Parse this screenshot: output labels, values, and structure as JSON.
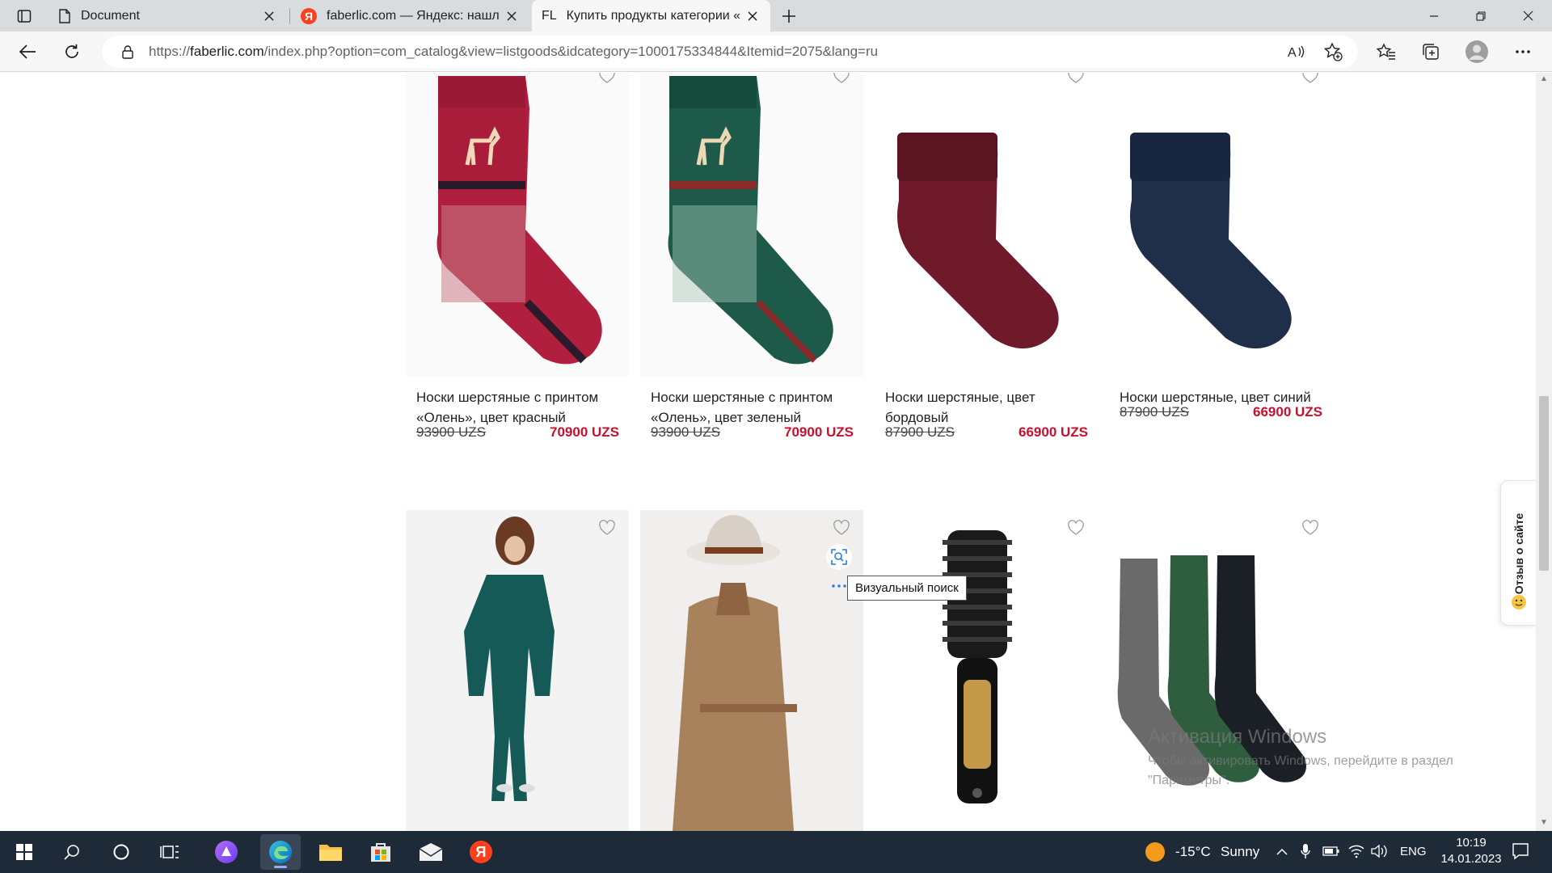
{
  "browser": {
    "tabs": [
      {
        "label": "Document",
        "icon": "document-icon"
      },
      {
        "label": "faberlic.com — Яндекс: нашлось",
        "icon": "yandex-icon"
      },
      {
        "label": "Купить продукты категории «М",
        "icon": "faberlic-icon",
        "favicon_text": "FL"
      }
    ],
    "address": {
      "url_prefix": "https://",
      "url_host": "faberlic.com",
      "url_path": "/index.php?option=com_catalog&view=listgoods&idcategory=1000175334844&Itemid=2075&lang=ru"
    }
  },
  "products": [
    {
      "title": "Носки шерстяные с принтом «Олень», цвет красный",
      "old_price": "93900 UZS",
      "price": "70900 UZS"
    },
    {
      "title": "Носки шерстяные с принтом «Олень», цвет зеленый",
      "old_price": "93900 UZS",
      "price": "70900 UZS"
    },
    {
      "title": "Носки шерстяные, цвет бордовый",
      "old_price": "87900 UZS",
      "price": "66900 UZS"
    },
    {
      "title": "Носки шерстяные, цвет синий",
      "old_price": "87900 UZS",
      "price": "66900 UZS"
    }
  ],
  "overlay": {
    "visual_search_tooltip": "Визуальный поиск",
    "feedback_tab": "Отзыв о сайте",
    "watermark_title": "Активация Windows",
    "watermark_text": "Чтобы активировать Windows, перейдите в раздел \"Параметры\"."
  },
  "taskbar": {
    "weather_temp": "-15°C",
    "weather_text": "Sunny",
    "language": "ENG",
    "time": "10:19",
    "date": "14.01.2023"
  },
  "colors": {
    "price_red": "#c8102e",
    "taskbar_bg": "#1e2a38",
    "tab_strip_bg": "#d9dcdf"
  }
}
